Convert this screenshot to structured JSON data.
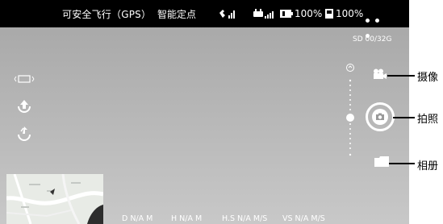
{
  "status_bar": {
    "flight_status": "可安全飞行（GPS）",
    "mode": "智能定点",
    "battery_aircraft": "100%",
    "battery_remote": "100%"
  },
  "storage": {
    "sd_label": "SD 00/32G"
  },
  "telemetry": {
    "distance": "D N/A M",
    "height": "H N/A M",
    "h_speed": "H.S N/A M/S",
    "v_speed": "VS  N/A M/S"
  },
  "callouts": {
    "camera_mode": "摄像",
    "shutter": "拍照",
    "album": "相册"
  },
  "colors": {
    "status_bar_bg": "#000000",
    "screen_bg": "#b4b4b4",
    "text": "#ffffff"
  }
}
